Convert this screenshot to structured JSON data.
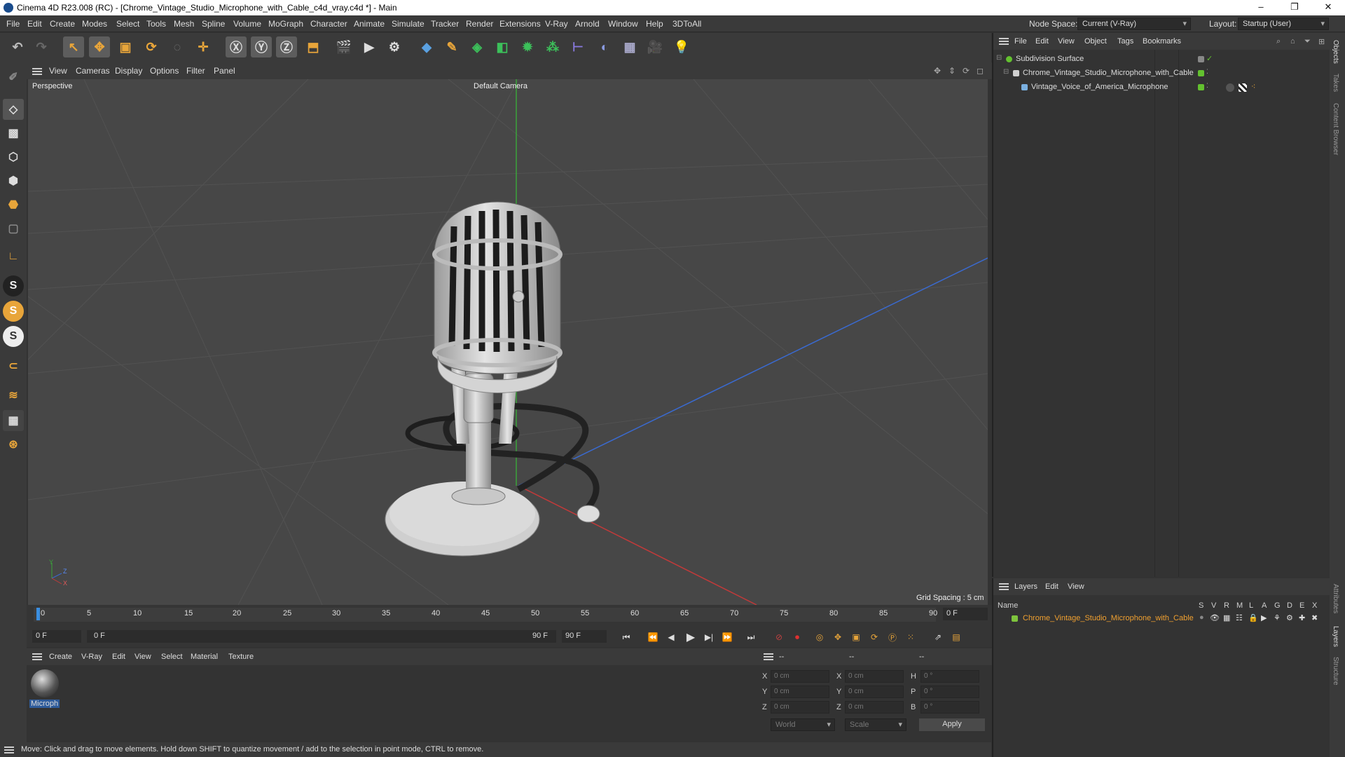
{
  "title_bar": {
    "title": "Cinema 4D R23.008 (RC) - [Chrome_Vintage_Studio_Microphone_with_Cable_c4d_vray.c4d *] - Main",
    "minimize": "–",
    "maximize": "❐",
    "close": "✕"
  },
  "menu": {
    "items": [
      "File",
      "Edit",
      "Create",
      "Modes",
      "Select",
      "Tools",
      "Mesh",
      "Spline",
      "Volume",
      "MoGraph",
      "Character",
      "Animate",
      "Simulate",
      "Tracker",
      "Render",
      "Extensions",
      "V-Ray",
      "Arnold",
      "Window",
      "Help",
      "3DToAll"
    ],
    "node_space_label": "Node Space:",
    "node_space_value": "Current (V-Ray)",
    "layout_label": "Layout:",
    "layout_value": "Startup (User)"
  },
  "viewport": {
    "menu": [
      "View",
      "Cameras",
      "Display",
      "Options",
      "Filter",
      "Panel"
    ],
    "name": "Perspective",
    "camera": "Default Camera",
    "grid_spacing": "Grid Spacing : 5 cm",
    "axis_y": "Y",
    "axis_z": "Z",
    "axis_x": "X"
  },
  "timeline": {
    "ticks": [
      "0",
      "5",
      "10",
      "15",
      "20",
      "25",
      "30",
      "35",
      "40",
      "45",
      "50",
      "55",
      "60",
      "65",
      "70",
      "75",
      "80",
      "85",
      "90"
    ],
    "current_frame_field": "0 F",
    "start_field": "0 F",
    "range_start": "0 F",
    "range_end": "90 F",
    "end_field": "90 F"
  },
  "material_bar": {
    "menu": [
      "Create",
      "V-Ray",
      "Edit",
      "View",
      "Select",
      "Material",
      "Texture"
    ],
    "material_name": "Microph"
  },
  "coordinates": {
    "headers": [
      "--",
      "--",
      "--"
    ],
    "rows": [
      {
        "axis": "X",
        "pos": "0 cm",
        "axis2": "X",
        "size": "0 cm",
        "axis3": "H",
        "rot": "0 °"
      },
      {
        "axis": "Y",
        "pos": "0 cm",
        "axis2": "Y",
        "size": "0 cm",
        "axis3": "P",
        "rot": "0 °"
      },
      {
        "axis": "Z",
        "pos": "0 cm",
        "axis2": "Z",
        "size": "0 cm",
        "axis3": "B",
        "rot": "0 °"
      }
    ],
    "world": "World",
    "scale": "Scale",
    "apply": "Apply"
  },
  "status_text": "Move: Click and drag to move elements. Hold down SHIFT to quantize movement / add to the selection in point mode, CTRL to remove.",
  "objects_panel": {
    "menu": [
      "File",
      "Edit",
      "View",
      "Object",
      "Tags",
      "Bookmarks"
    ],
    "objects": [
      {
        "name": "Subdivision Surface"
      },
      {
        "name": "Chrome_Vintage_Studio_Microphone_with_Cable"
      },
      {
        "name": "Vintage_Voice_of_America_Microphone"
      }
    ]
  },
  "layers_panel": {
    "menu": [
      "Layers",
      "Edit",
      "View"
    ],
    "name_header": "Name",
    "flag_headers": [
      "S",
      "V",
      "R",
      "M",
      "L",
      "A",
      "G",
      "D",
      "E",
      "X"
    ],
    "layer_name": "Chrome_Vintage_Studio_Microphone_with_Cable",
    "layer_color": "#7ec43d"
  },
  "side_tabs": [
    "Objects",
    "Takes",
    "Content Browser",
    "Attributes",
    "Layers",
    "Structure"
  ],
  "colors": {
    "accent_orange": "#f0a030",
    "green_tag": "#63c12f",
    "x_axis": "#c03a3a",
    "y_axis": "#3aa43a",
    "z_axis": "#3a6ad0"
  }
}
